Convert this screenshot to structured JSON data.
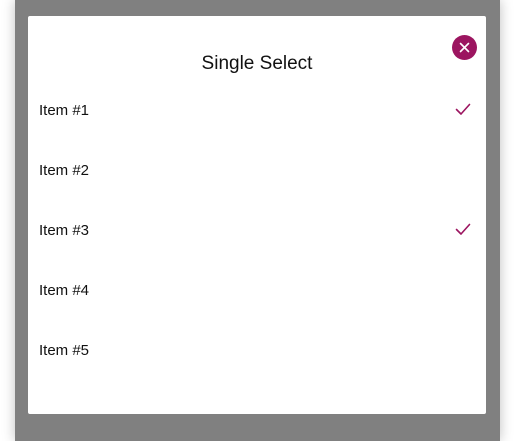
{
  "dialog": {
    "title": "Single Select",
    "close_icon": "close-icon",
    "accent_color": "#9c1560",
    "backdrop_color": "#808080"
  },
  "items": [
    {
      "label": "Item #1",
      "selected": true
    },
    {
      "label": "Item #2",
      "selected": false
    },
    {
      "label": "Item #3",
      "selected": true
    },
    {
      "label": "Item #4",
      "selected": false
    },
    {
      "label": "Item #5",
      "selected": false
    }
  ]
}
